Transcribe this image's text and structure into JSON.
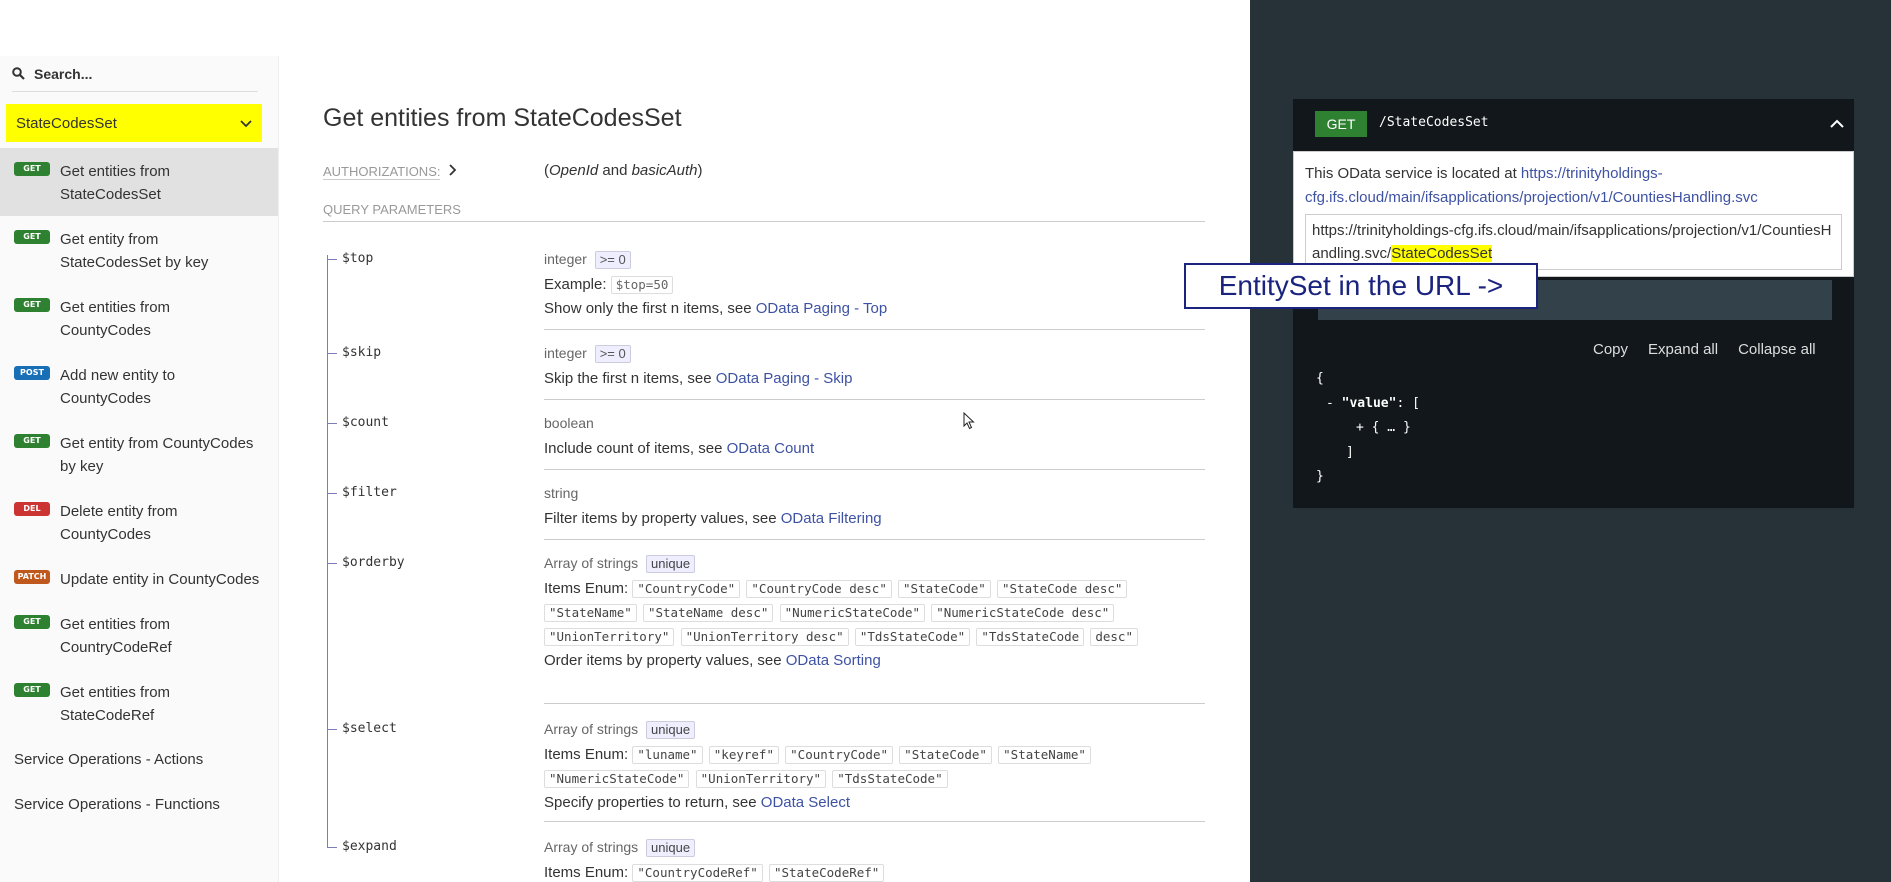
{
  "sidebar": {
    "search_placeholder": "Search...",
    "selector_label": "StateCodesSet",
    "items": [
      {
        "method": "GET",
        "label": "Get entities from StateCodesSet",
        "active": true
      },
      {
        "method": "GET",
        "label": "Get entity from StateCodesSet by key"
      },
      {
        "method": "GET",
        "label": "Get entities from CountyCodes"
      },
      {
        "method": "POST",
        "label": "Add new entity to CountyCodes"
      },
      {
        "method": "GET",
        "label": "Get entity from CountyCodes by key"
      },
      {
        "method": "DEL",
        "label": "Delete entity from CountyCodes"
      },
      {
        "method": "PATCH",
        "label": "Update entity in CountyCodes"
      },
      {
        "method": "GET",
        "label": "Get entities from CountryCodeRef"
      },
      {
        "method": "GET",
        "label": "Get entities from StateCodeRef"
      }
    ],
    "section_actions": "Service Operations - Actions",
    "section_next": "Service Operations - Functions"
  },
  "main": {
    "title": "Get entities from StateCodesSet",
    "auth_label": "AUTHORIZATIONS:",
    "auth_value_open": "(",
    "auth_openid": "OpenId",
    "auth_and": " and ",
    "auth_basic": "basicAuth",
    "auth_value_close": ")",
    "query_params_label": "QUERY PARAMETERS",
    "params": {
      "top": {
        "name": "$top",
        "type": "integer",
        "constraint": ">= 0",
        "example_label": "Example:",
        "example": "$top=50",
        "desc": "Show only the first n items, see ",
        "link": "OData Paging - Top"
      },
      "skip": {
        "name": "$skip",
        "type": "integer",
        "constraint": ">= 0",
        "desc": "Skip the first n items, see ",
        "link": "OData Paging - Skip"
      },
      "count": {
        "name": "$count",
        "type": "boolean",
        "desc": "Include count of items, see ",
        "link": "OData Count"
      },
      "filter": {
        "name": "$filter",
        "type": "string",
        "desc": "Filter items by property values, see ",
        "link": "OData Filtering"
      },
      "orderby": {
        "name": "$orderby",
        "type": "Array of strings",
        "constraint": "unique",
        "enum_label": "Items Enum:",
        "enum": [
          "\"CountryCode\"",
          "\"CountryCode desc\"",
          "\"StateCode\"",
          "\"StateCode desc\"",
          "\"StateName\"",
          "\"StateName desc\"",
          "\"NumericStateCode\"",
          "\"NumericStateCode desc\"",
          "\"UnionTerritory\"",
          "\"UnionTerritory desc\"",
          "\"TdsStateCode\"",
          "\"TdsStateCode",
          "desc\""
        ],
        "desc": "Order items by property values, see ",
        "link": "OData Sorting"
      },
      "select": {
        "name": "$select",
        "type": "Array of strings",
        "constraint": "unique",
        "enum_label": "Items Enum:",
        "enum": [
          "\"luname\"",
          "\"keyref\"",
          "\"CountryCode\"",
          "\"StateCode\"",
          "\"StateName\"",
          "\"NumericStateCode\"",
          "\"UnionTerritory\"",
          "\"TdsStateCode\""
        ],
        "desc": "Specify properties to return, see ",
        "link": "OData Select"
      },
      "expand": {
        "name": "$expand",
        "type": "Array of strings",
        "constraint": "unique",
        "enum_label": "Items Enum:",
        "enum": [
          "\"CountryCodeRef\"",
          "\"StateCodeRef\""
        ]
      }
    }
  },
  "right": {
    "method": "GET",
    "path": "/StateCodesSet",
    "tip_text": "This OData service is located at ",
    "tip_link": "https://trinityholdings-cfg.ifs.cloud/main/ifsapplications/projection/v1/CountiesHandling.svc",
    "url_prefix": "https://trinityholdings-cfg.ifs.cloud/main/ifsapplications/projection/v1/CountiesHandling.svc/",
    "url_entity": "StateCodesSet",
    "callout": "EntitySet in the URL ->",
    "actions": {
      "copy": "Copy",
      "expand": "Expand all",
      "collapse": "Collapse all"
    },
    "json": {
      "open": "{",
      "minus": "- ",
      "key": "\"value\"",
      "colon": ": [",
      "plus_item": "+ { … }",
      "close_arr": "]",
      "close": "}"
    }
  }
}
